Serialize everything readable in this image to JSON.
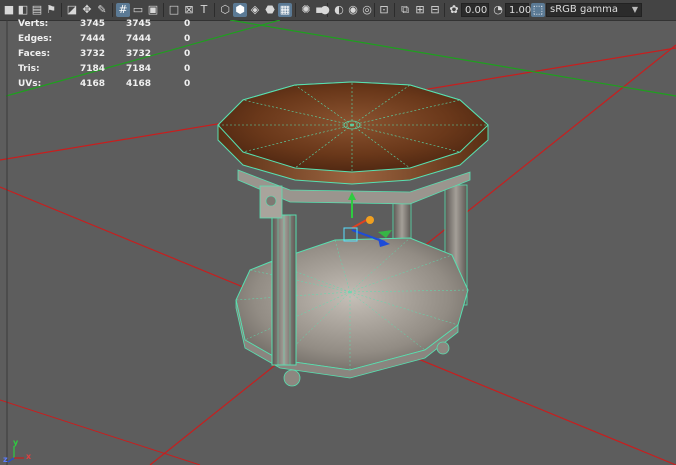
{
  "toolbar": {
    "exposure_value": "0.00",
    "gamma_value": "1.00",
    "color_space": "sRGB gamma",
    "icons": [
      "camera-icon",
      "select-camera-icon",
      "camera-attributes-icon",
      "bookmark-icon",
      "image-plane-icon",
      "two-d-pan-zoom-icon",
      "grease-pencil-icon",
      "grid-icon",
      "film-gate-icon",
      "resolution-gate-icon",
      "gate-mask-icon",
      "field-chart-icon",
      "safe-action-icon",
      "wireframe-icon",
      "smooth-shade-icon",
      "default-material-icon",
      "textured-icon",
      "lights-icon",
      "shadows-icon",
      "screen-space-ambient-occlusion-icon",
      "motion-blur-icon",
      "anti-aliasing-icon",
      "depth-of-field-icon",
      "isolate-select-icon",
      "xray-icon",
      "xray-joints-icon",
      "xray-components-icon",
      "exposure-icon",
      "gamma-icon",
      "color-management-icon"
    ]
  },
  "hud": {
    "rows": [
      {
        "label": "Verts:",
        "v1": "3745",
        "v2": "3745",
        "v3": "0"
      },
      {
        "label": "Edges:",
        "v1": "7444",
        "v2": "7444",
        "v3": "0"
      },
      {
        "label": "Faces:",
        "v1": "3732",
        "v2": "3732",
        "v3": "0"
      },
      {
        "label": "Tris:",
        "v1": "7184",
        "v2": "7184",
        "v3": "0"
      },
      {
        "label": "UVs:",
        "v1": "4168",
        "v2": "4168",
        "v3": "0"
      }
    ]
  },
  "axis": {
    "x_label": "x",
    "y_label": "y",
    "z_label": "z"
  },
  "colors": {
    "viewport_bg": "#5d5d5d",
    "grid_x_axis": "#c81e1e",
    "grid_z_axis": "#1ea01e",
    "wire_highlight": "#58e0b0",
    "wood_top": "#6b3a1c",
    "shelf_fabric": "#a8a29a"
  }
}
